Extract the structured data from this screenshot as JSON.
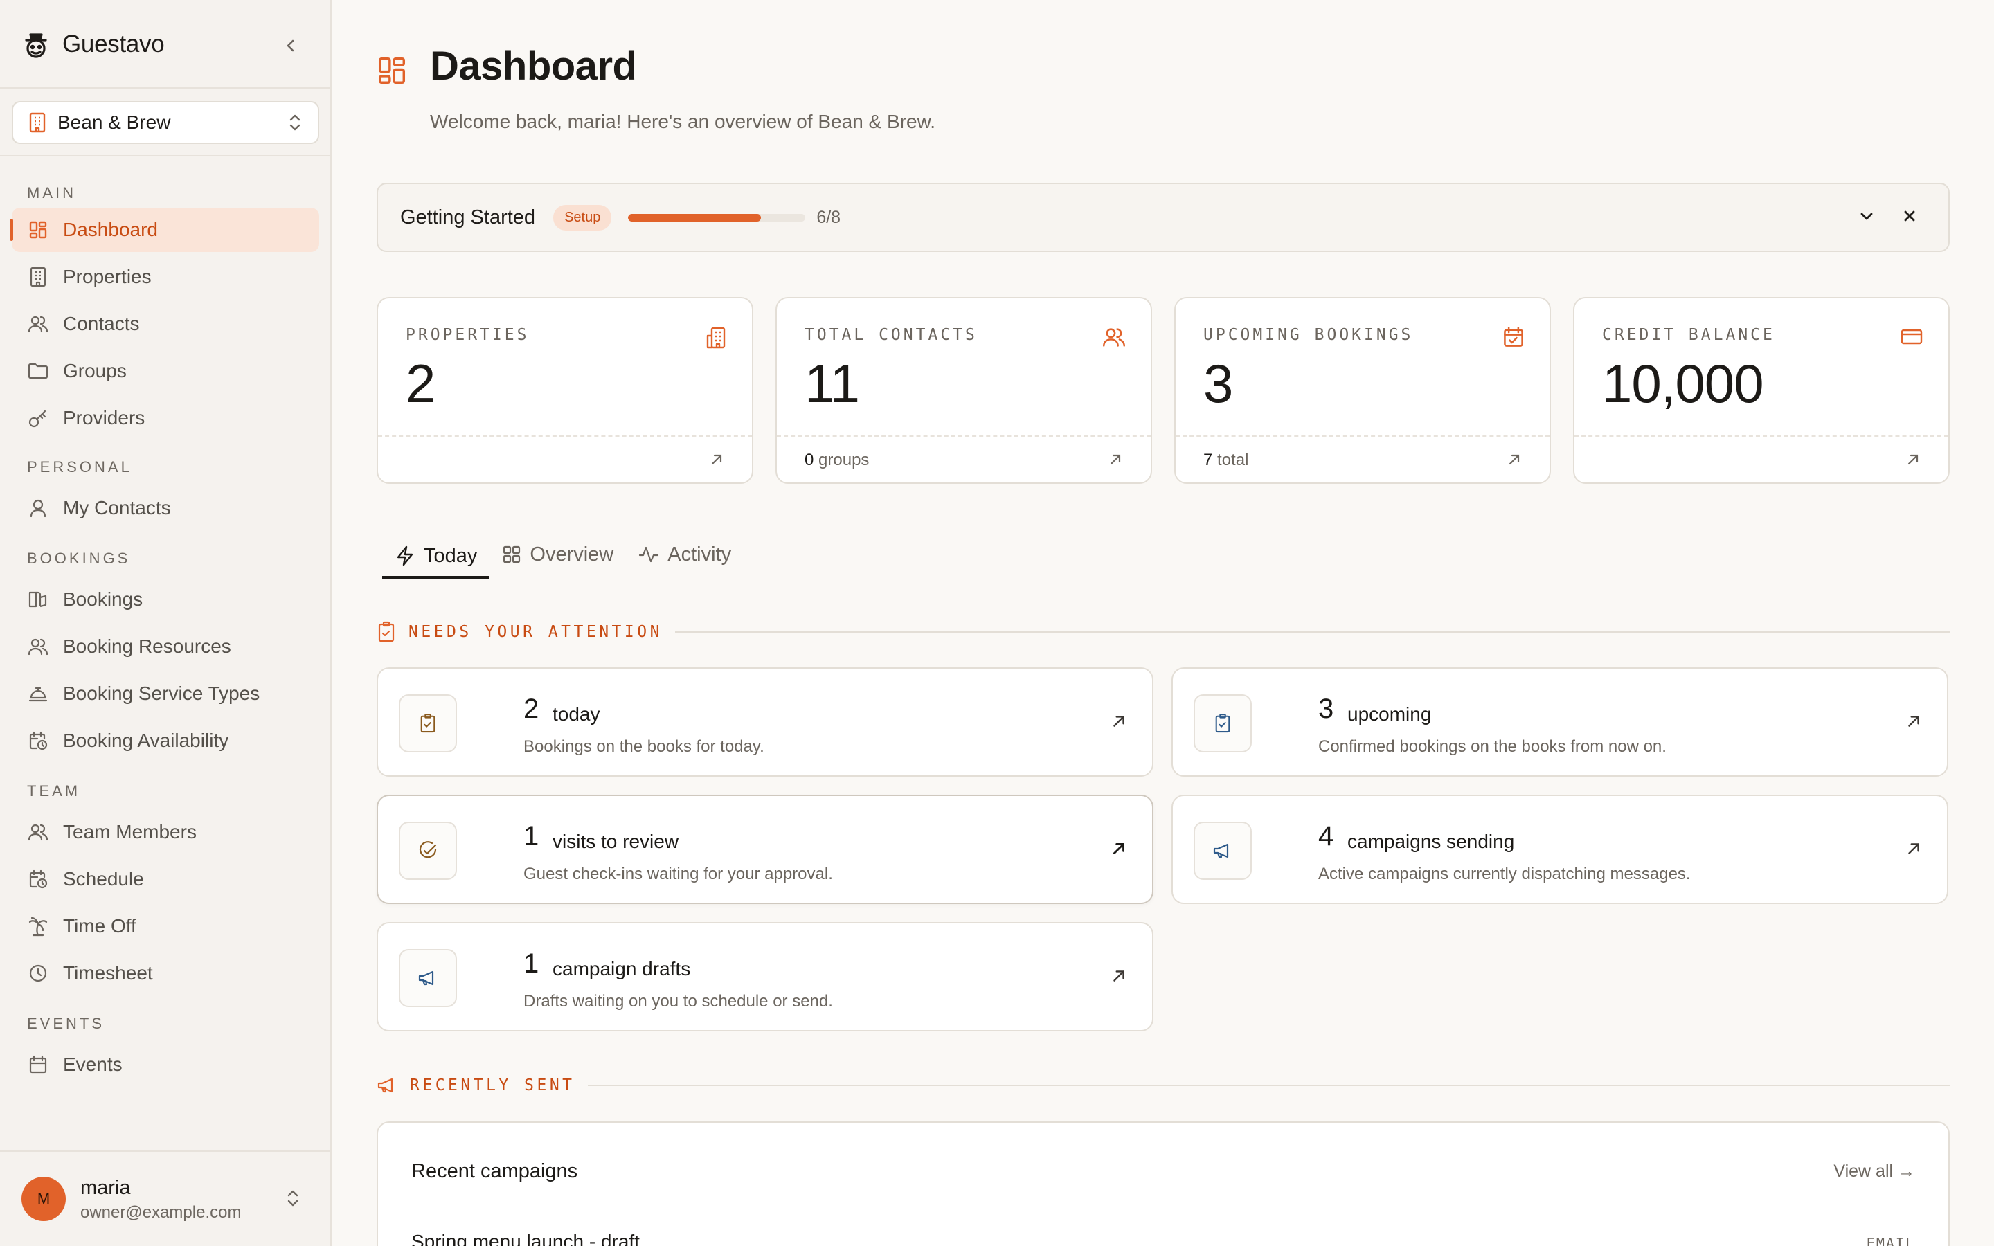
{
  "app": {
    "name": "Guestavo"
  },
  "org": {
    "name": "Bean & Brew"
  },
  "nav": {
    "sections": [
      {
        "title": "MAIN",
        "items": [
          {
            "label": "Dashboard",
            "icon": "dashboard-icon",
            "active": true
          },
          {
            "label": "Properties",
            "icon": "building-icon"
          },
          {
            "label": "Contacts",
            "icon": "users-icon"
          },
          {
            "label": "Groups",
            "icon": "folder-icon"
          },
          {
            "label": "Providers",
            "icon": "key-icon"
          }
        ]
      },
      {
        "title": "PERSONAL",
        "items": [
          {
            "label": "My Contacts",
            "icon": "user-icon"
          }
        ]
      },
      {
        "title": "BOOKINGS",
        "items": [
          {
            "label": "Bookings",
            "icon": "book-open-icon"
          },
          {
            "label": "Booking Resources",
            "icon": "users-icon"
          },
          {
            "label": "Booking Service Types",
            "icon": "concierge-bell-icon"
          },
          {
            "label": "Booking Availability",
            "icon": "calendar-clock-icon"
          }
        ]
      },
      {
        "title": "TEAM",
        "items": [
          {
            "label": "Team Members",
            "icon": "users-icon"
          },
          {
            "label": "Schedule",
            "icon": "calendar-clock-icon"
          },
          {
            "label": "Time Off",
            "icon": "palm-tree-icon"
          },
          {
            "label": "Timesheet",
            "icon": "clock-icon"
          }
        ]
      },
      {
        "title": "EVENTS",
        "items": [
          {
            "label": "Events",
            "icon": "calendar-icon"
          }
        ]
      }
    ]
  },
  "user": {
    "initial": "M",
    "name": "maria",
    "email": "owner@example.com"
  },
  "page": {
    "title": "Dashboard",
    "subtitle": "Welcome back, maria! Here's an overview of Bean & Brew."
  },
  "getting_started": {
    "title": "Getting Started",
    "badge": "Setup",
    "progress": 0.75,
    "count": "6/8"
  },
  "stats": [
    {
      "label": "PROPERTIES",
      "value": "2",
      "icon": "building-icon",
      "foot_num": "",
      "foot_text": ""
    },
    {
      "label": "TOTAL CONTACTS",
      "value": "11",
      "icon": "users-icon",
      "foot_num": "0",
      "foot_text": "groups"
    },
    {
      "label": "UPCOMING BOOKINGS",
      "value": "3",
      "icon": "calendar-check-icon",
      "foot_num": "7",
      "foot_text": "total"
    },
    {
      "label": "CREDIT BALANCE",
      "value": "10,000",
      "icon": "credit-card-icon",
      "foot_num": "",
      "foot_text": ""
    }
  ],
  "tabs": [
    {
      "label": "Today",
      "icon": "zap-icon",
      "active": true
    },
    {
      "label": "Overview",
      "icon": "grid-icon"
    },
    {
      "label": "Activity",
      "icon": "activity-icon"
    }
  ],
  "attention": {
    "title": "NEEDS YOUR ATTENTION",
    "cards": [
      {
        "count": "2",
        "title": "today",
        "desc": "Bookings on the books for today.",
        "icon": "clipboard-check-icon"
      },
      {
        "count": "3",
        "title": "upcoming",
        "desc": "Confirmed bookings on the books from now on.",
        "icon": "clipboard-check-icon"
      },
      {
        "count": "1",
        "title": "visits to review",
        "desc": "Guest check-ins waiting for your approval.",
        "icon": "circle-check-icon"
      },
      {
        "count": "4",
        "title": "campaigns sending",
        "desc": "Active campaigns currently dispatching messages.",
        "icon": "megaphone-icon"
      },
      {
        "count": "1",
        "title": "campaign drafts",
        "desc": "Drafts waiting on you to schedule or send.",
        "icon": "megaphone-icon"
      }
    ]
  },
  "recent": {
    "title": "RECENTLY SENT",
    "card_title": "Recent campaigns",
    "view_all": "View all →",
    "rows": [
      {
        "name": "Spring menu launch - draft",
        "channel": "EMAIL"
      }
    ]
  },
  "colors": {
    "accent": "#e1622a",
    "accent_text": "#c84b12",
    "background": "#faf8f5"
  }
}
